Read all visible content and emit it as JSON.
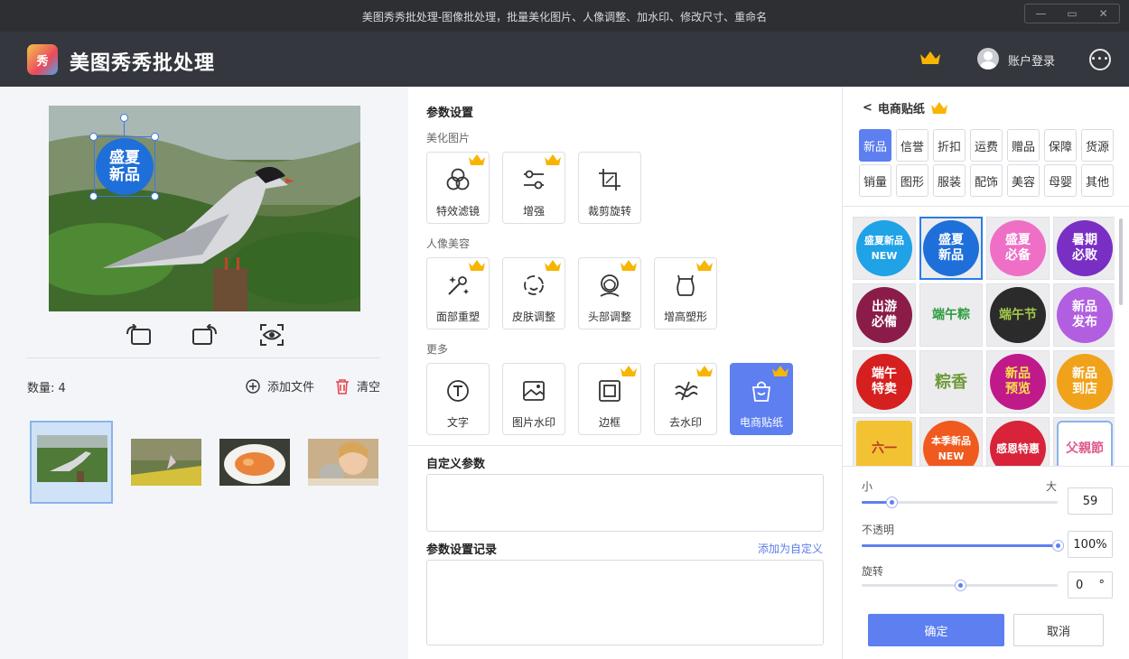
{
  "window": {
    "title": "美图秀秀批处理-图像批处理，批量美化图片、人像调整、加水印、修改尺寸、重命名",
    "min": "—",
    "max": "▭",
    "close": "✕"
  },
  "app": {
    "logo_text": "秀",
    "name": "美图秀秀批处理",
    "login": "账户登录",
    "more": "•••"
  },
  "preview": {
    "sticker_text": "盛夏新品"
  },
  "files": {
    "count_label": "数量: ",
    "count": "4",
    "add_label": "添加文件",
    "clear_label": "清空"
  },
  "params": {
    "title": "参数设置",
    "sections": [
      {
        "label": "美化图片",
        "tools": [
          {
            "label": "特效滤镜",
            "crown": true
          },
          {
            "label": "增强",
            "crown": true
          },
          {
            "label": "裁剪旋转",
            "crown": false
          }
        ]
      },
      {
        "label": "人像美容",
        "tools": [
          {
            "label": "面部重塑",
            "crown": true
          },
          {
            "label": "皮肤调整",
            "crown": true
          },
          {
            "label": "头部调整",
            "crown": true
          },
          {
            "label": "增高塑形",
            "crown": true
          }
        ]
      },
      {
        "label": "更多",
        "tools": [
          {
            "label": "文字",
            "crown": false
          },
          {
            "label": "图片水印",
            "crown": false
          },
          {
            "label": "边框",
            "crown": true
          },
          {
            "label": "去水印",
            "crown": true
          },
          {
            "label": "电商贴纸",
            "crown": true,
            "active": true
          }
        ]
      }
    ],
    "custom_title": "自定义参数",
    "history_title": "参数设置记录",
    "add_custom": "添加为自定义"
  },
  "stickers": {
    "title": "电商贴纸",
    "back": "<",
    "categories": [
      "新品",
      "信誉",
      "折扣",
      "运费",
      "赠品",
      "保障",
      "货源",
      "销量",
      "图形",
      "服装",
      "配饰",
      "美容",
      "母婴",
      "其他"
    ],
    "active_category": "新品",
    "items": [
      {
        "text": "盛夏新品NEW",
        "color": "#1fa2e6"
      },
      {
        "text": "盛夏新品",
        "color": "#1e6fd9"
      },
      {
        "text": "盛夏必备",
        "color": "#ef6fc6"
      },
      {
        "text": "暑期必败",
        "color": "#7a2fc4"
      },
      {
        "text": "出游必備",
        "color": "#8b1c4a"
      },
      {
        "text": "端午粽",
        "color": "#2f9a3d"
      },
      {
        "text": "端午节",
        "color": "#2b2b2b"
      },
      {
        "text": "新品发布",
        "color": "#b15fe0"
      },
      {
        "text": "端午特卖",
        "color": "#d61f1f"
      },
      {
        "text": "粽香",
        "color": "#6e9b3a"
      },
      {
        "text": "新品预览",
        "color": "#c0198a"
      },
      {
        "text": "新品到店",
        "color": "#f0a21b"
      },
      {
        "text": "六一",
        "color": "#f2c232"
      },
      {
        "text": "本季新品NEW",
        "color": "#f05a1e"
      },
      {
        "text": "感恩特惠",
        "color": "#d8233b"
      },
      {
        "text": "父親節",
        "color": "#e05a8c"
      }
    ],
    "size": {
      "min_label": "小",
      "max_label": "大",
      "value": "59",
      "fraction": 0.15
    },
    "opacity": {
      "label": "不透明",
      "value": "100%",
      "fraction": 1.0
    },
    "rotate": {
      "label": "旋转",
      "value": "0",
      "unit": "°",
      "fraction": 0.5
    },
    "ok": "确定",
    "cancel": "取消"
  }
}
